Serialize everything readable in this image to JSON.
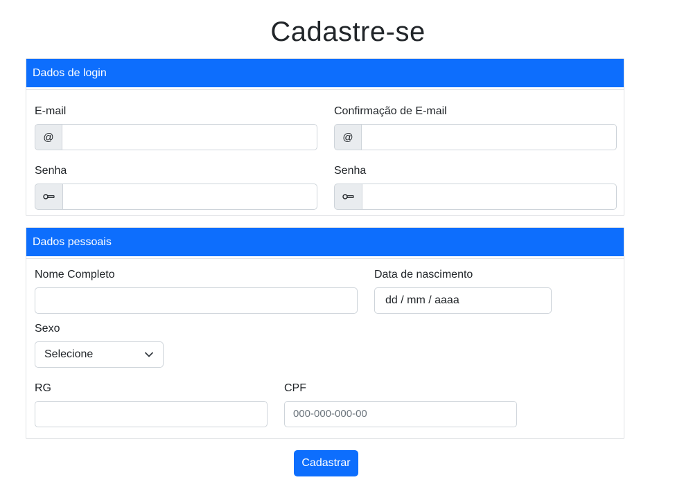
{
  "page": {
    "title": "Cadastre-se"
  },
  "login_card": {
    "header": "Dados de login",
    "email_label": "E-mail",
    "email_addon": "@",
    "email_confirm_label": "Confirmação de E-mail",
    "email_confirm_addon": "@",
    "password_label": "Senha",
    "password_confirm_label": "Senha"
  },
  "personal_card": {
    "header": "Dados pessoais",
    "full_name_label": "Nome Completo",
    "birth_date_label": "Data de nascimento",
    "birth_date_value": "dd / mm / aaaa",
    "sex_label": "Sexo",
    "sex_selected": "Selecione",
    "rg_label": "RG",
    "cpf_label": "CPF",
    "cpf_placeholder": "000-000-000-00"
  },
  "actions": {
    "submit_label": "Cadastrar"
  },
  "icons": {
    "key": "key-icon",
    "chevron": "chevron-down-icon"
  },
  "colors": {
    "primary": "#0d6efd",
    "border": "#ced4da",
    "addon_bg": "#e9ecef"
  }
}
